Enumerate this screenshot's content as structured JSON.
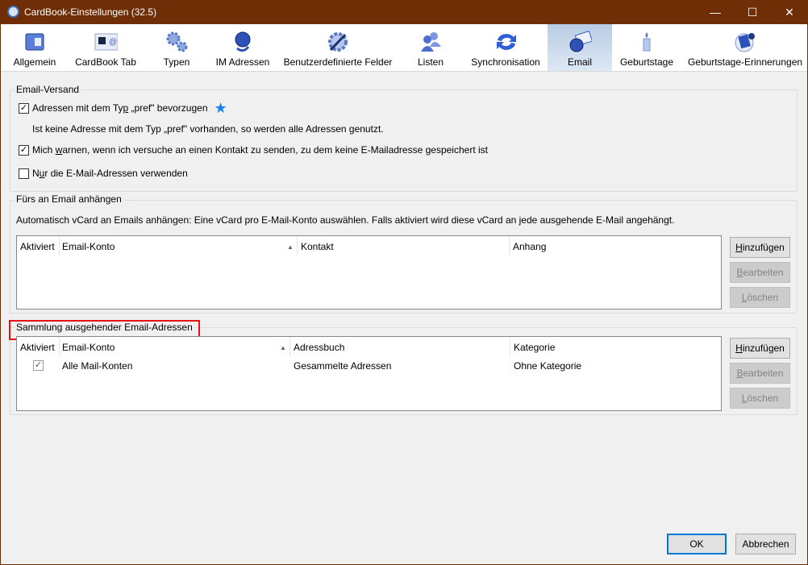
{
  "window": {
    "title": "CardBook-Einstellungen (32.5)",
    "controls": [
      "minimize",
      "maximize",
      "close"
    ]
  },
  "tabs": [
    {
      "label": "Allgemein",
      "icon": "address-book-icon"
    },
    {
      "label": "CardBook Tab",
      "icon": "contact-card-icon"
    },
    {
      "label": "Typen",
      "icon": "gears-icon"
    },
    {
      "label": "IM Adressen",
      "icon": "im-globe-icon"
    },
    {
      "label": "Benutzerdefinierte Felder",
      "icon": "wrench-gear-icon"
    },
    {
      "label": "Listen",
      "icon": "users-icon"
    },
    {
      "label": "Synchronisation",
      "icon": "sync-icon"
    },
    {
      "label": "Email",
      "icon": "email-globe-icon",
      "selected": true
    },
    {
      "label": "Geburtstage",
      "icon": "candle-icon"
    },
    {
      "label": "Geburtstage-Erinnerungen",
      "icon": "calendar-rose-icon"
    }
  ],
  "email_versand": {
    "legend": "Email-Versand",
    "pref": {
      "pre": "Adressen mit dem Ty",
      "acc": "p",
      "post": " „pref\" bevorzugen",
      "checked": true
    },
    "pref_hint": "Ist keine Adresse mit dem Typ „pref\" vorhanden, so werden alle Adressen genutzt.",
    "warn": {
      "pre": "Mich ",
      "acc": "w",
      "post": "arnen, wenn ich versuche an einen Kontakt zu senden, zu dem keine E-Mailadresse gespeichert ist",
      "checked": true
    },
    "only": {
      "pre": "N",
      "acc": "u",
      "post": "r die E-Mail-Adressen verwenden",
      "checked": false
    }
  },
  "attach": {
    "legend": "Fürs an Email anhängen",
    "desc": "Automatisch vCard an Emails anhängen: Eine vCard pro E-Mail-Konto auswählen. Falls aktiviert wird diese vCard an jede ausgehende E-Mail angehängt.",
    "columns": [
      "Aktiviert",
      "Email-Konto",
      "Kontakt",
      "Anhang"
    ],
    "rows": []
  },
  "collect": {
    "legend": "Sammlung ausgehender Email-Adressen",
    "columns": [
      "Aktiviert",
      "Email-Konto",
      "Adressbuch",
      "Kategorie"
    ],
    "rows": [
      {
        "enabled": true,
        "account": "Alle Mail-Konten",
        "book": "Gesammelte Adressen",
        "category": "Ohne Kategorie"
      }
    ]
  },
  "buttons": {
    "add": {
      "acc": "H",
      "rest": "inzufügen"
    },
    "edit": {
      "acc": "B",
      "rest": "earbeiten"
    },
    "del": {
      "acc": "L",
      "rest": "öschen"
    },
    "ok": "OK",
    "cancel": "Abbrechen"
  },
  "colors": {
    "titlebar": "#6f2e05",
    "highlight": "#e81010",
    "star": "#1e7ef0"
  }
}
